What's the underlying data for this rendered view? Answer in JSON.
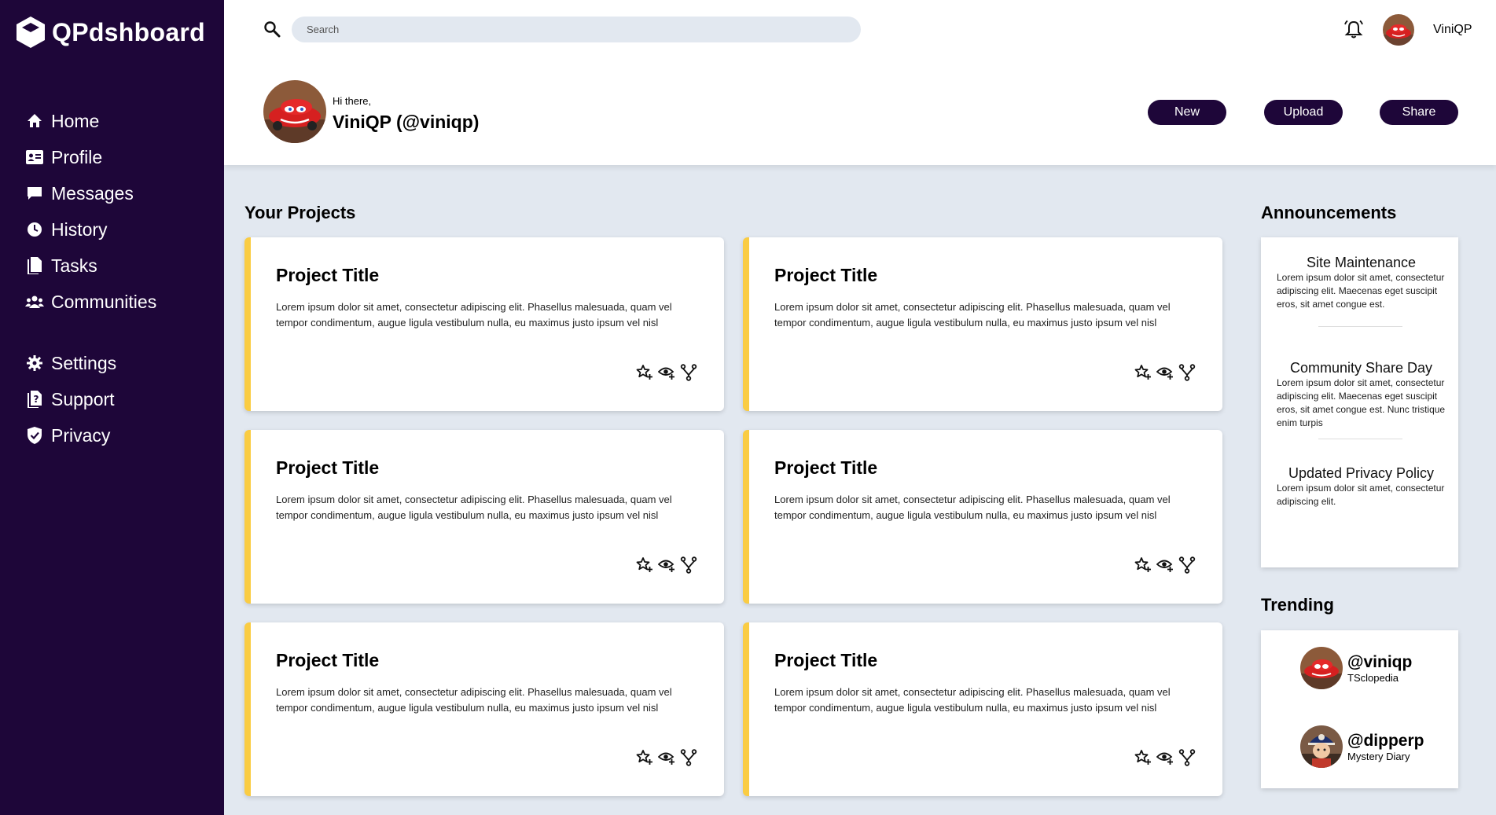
{
  "app": {
    "name": "QPdshboard"
  },
  "sidebar": {
    "items": [
      {
        "label": "Home",
        "icon": "home-icon"
      },
      {
        "label": "Profile",
        "icon": "id-card-icon"
      },
      {
        "label": "Messages",
        "icon": "message-icon"
      },
      {
        "label": "History",
        "icon": "clock-icon"
      },
      {
        "label": "Tasks",
        "icon": "document-icon"
      },
      {
        "label": "Communities",
        "icon": "users-icon"
      }
    ],
    "secondary": [
      {
        "label": "Settings",
        "icon": "gear-icon"
      },
      {
        "label": "Support",
        "icon": "question-icon"
      },
      {
        "label": "Privacy",
        "icon": "shield-icon"
      }
    ]
  },
  "header": {
    "search_placeholder": "Search",
    "username": "ViniQP",
    "greeting": "Hi there,",
    "handle": "ViniQP (@viniqp)",
    "buttons": {
      "new": "New",
      "upload": "Upload",
      "share": "Share"
    }
  },
  "projects": {
    "title": "Your Projects",
    "items": [
      {
        "title": "Project Title",
        "desc": "Lorem ipsum dolor sit amet, consectetur adipiscing elit. Phasellus malesuada, quam vel tempor condimentum, augue ligula vestibulum nulla, eu maximus justo ipsum vel nisl"
      },
      {
        "title": "Project Title",
        "desc": "Lorem ipsum dolor sit amet, consectetur adipiscing elit. Phasellus malesuada, quam vel tempor condimentum, augue ligula vestibulum nulla, eu maximus justo ipsum vel nisl"
      },
      {
        "title": "Project Title",
        "desc": "Lorem ipsum dolor sit amet, consectetur adipiscing elit. Phasellus malesuada, quam vel tempor condimentum, augue ligula vestibulum nulla, eu maximus justo ipsum vel nisl"
      },
      {
        "title": "Project Title",
        "desc": "Lorem ipsum dolor sit amet, consectetur adipiscing elit. Phasellus malesuada, quam vel tempor condimentum, augue ligula vestibulum nulla, eu maximus justo ipsum vel nisl"
      },
      {
        "title": "Project Title",
        "desc": "Lorem ipsum dolor sit amet, consectetur adipiscing elit. Phasellus malesuada, quam vel tempor condimentum, augue ligula vestibulum nulla, eu maximus justo ipsum vel nisl"
      },
      {
        "title": "Project Title",
        "desc": "Lorem ipsum dolor sit amet, consectetur adipiscing elit. Phasellus malesuada, quam vel tempor condimentum, augue ligula vestibulum nulla, eu maximus justo ipsum vel nisl"
      }
    ]
  },
  "announcements": {
    "title": "Announcements",
    "items": [
      {
        "title": "Site Maintenance",
        "body": "Lorem ipsum dolor sit amet, consectetur adipiscing elit. Maecenas eget suscipit eros, sit amet congue est."
      },
      {
        "title": "Community Share Day",
        "body": "Lorem ipsum dolor sit amet, consectetur adipiscing elit. Maecenas eget suscipit eros, sit amet congue est. Nunc tristique enim turpis"
      },
      {
        "title": "Updated Privacy Policy",
        "body": "Lorem ipsum dolor sit amet, consectetur adipiscing elit."
      }
    ]
  },
  "trending": {
    "title": "Trending",
    "items": [
      {
        "handle": "@viniqp",
        "project": "TSclopedia"
      },
      {
        "handle": "@dipperp",
        "project": "Mystery Diary"
      }
    ]
  },
  "colors": {
    "sidebar": "#1e0639",
    "accent": "#facc43",
    "background": "#e2e8f0"
  }
}
